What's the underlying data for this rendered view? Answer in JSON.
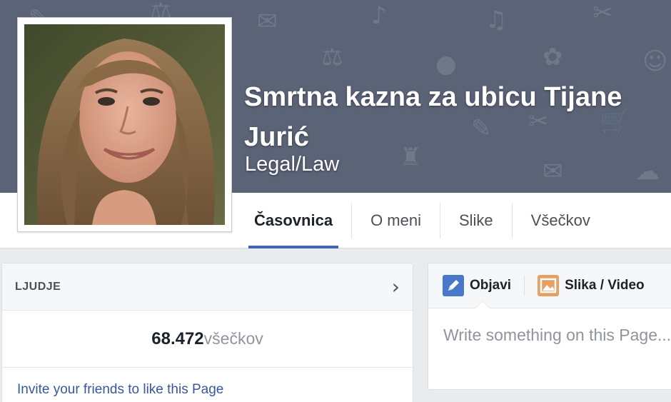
{
  "page": {
    "title": "Smrtna kazna za ubicu Tijane Jurić",
    "category": "Legal/Law"
  },
  "tabs": [
    {
      "label": "Časovnica",
      "active": true
    },
    {
      "label": "O meni",
      "active": false
    },
    {
      "label": "Slike",
      "active": false
    },
    {
      "label": "Všečkov",
      "active": false
    }
  ],
  "people": {
    "title": "LJUDJE",
    "like_count": "68.472",
    "like_suffix": "všečkov",
    "invite_text": "Invite your friends to like this Page"
  },
  "composer": {
    "post_tab": "Objavi",
    "photo_tab": "Slika / Video",
    "placeholder": "Write something on this Page..."
  },
  "icons": {
    "chevron": "chevron-right-icon",
    "post": "pencil-icon",
    "photo": "photo-icon"
  },
  "colors": {
    "cover": "#5b6377",
    "accent": "#4267b2",
    "link": "#365899"
  }
}
